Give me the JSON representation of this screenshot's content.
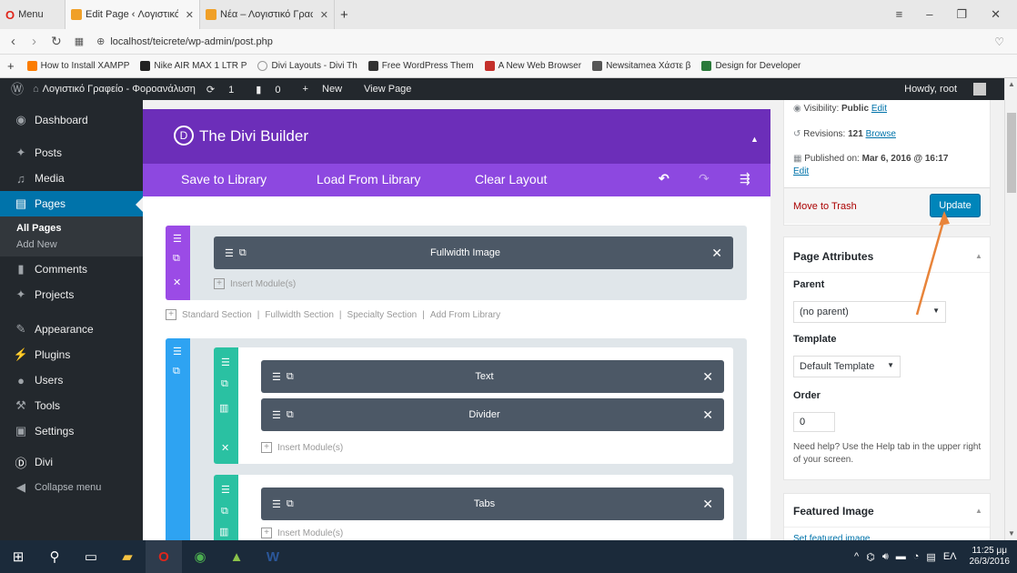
{
  "browser": {
    "menu_label": "Menu",
    "tabs": [
      {
        "label": "Edit Page ‹ Λογιστικό Γρα…"
      },
      {
        "label": "Νέα – Λογιστικό Γραφείο"
      }
    ],
    "url": "localhost/teicrete/wp-admin/post.php",
    "bookmarks": [
      {
        "label": "How to Install XAMPP"
      },
      {
        "label": "Nike AIR MAX 1 LTR P"
      },
      {
        "label": "Divi Layouts - Divi Th"
      },
      {
        "label": "Free WordPress Them"
      },
      {
        "label": "A New Web Browser"
      },
      {
        "label": "Newsitamea Χάστε β"
      },
      {
        "label": "Design for Developer"
      }
    ]
  },
  "adminbar": {
    "site_name": "Λογιστικό Γραφείο - Φοροανάλυση",
    "updates": "1",
    "comments": "0",
    "new_label": "New",
    "view_label": "View Page",
    "howdy": "Howdy, root"
  },
  "sidebar": {
    "items": [
      {
        "label": "Dashboard",
        "icon": "dashboard-icon"
      },
      {
        "label": "Posts",
        "icon": "pin-icon"
      },
      {
        "label": "Media",
        "icon": "media-icon"
      },
      {
        "label": "Pages",
        "icon": "page-icon"
      },
      {
        "label": "Comments",
        "icon": "comment-icon"
      },
      {
        "label": "Projects",
        "icon": "pin-icon"
      },
      {
        "label": "Appearance",
        "icon": "brush-icon"
      },
      {
        "label": "Plugins",
        "icon": "plug-icon"
      },
      {
        "label": "Users",
        "icon": "user-icon"
      },
      {
        "label": "Tools",
        "icon": "wrench-icon"
      },
      {
        "label": "Settings",
        "icon": "settings-icon"
      },
      {
        "label": "Divi",
        "icon": "divi-icon"
      },
      {
        "label": "Collapse menu",
        "icon": "collapse-icon"
      }
    ],
    "submenu": [
      "All Pages",
      "Add New"
    ]
  },
  "divi": {
    "title": "The Divi Builder",
    "save_library": "Save to Library",
    "load_library": "Load From Library",
    "clear_layout": "Clear Layout",
    "insert_module": "Insert Module(s)",
    "section_links": [
      "Standard Section",
      "Fullwidth Section",
      "Specialty Section",
      "Add From Library"
    ],
    "modules": [
      "Fullwidth Image",
      "Text",
      "Divider",
      "Tabs"
    ]
  },
  "publish": {
    "visibility_label": "Visibility:",
    "visibility_value": "Public",
    "edit": "Edit",
    "revisions_label": "Revisions:",
    "revisions_value": "121",
    "browse": "Browse",
    "published_label": "Published on:",
    "published_value": "Mar 6, 2016 @ 16:17",
    "trash": "Move to Trash",
    "update": "Update"
  },
  "attributes": {
    "title": "Page Attributes",
    "parent_label": "Parent",
    "parent_value": "(no parent)",
    "template_label": "Template",
    "template_value": "Default Template",
    "order_label": "Order",
    "order_value": "0",
    "help": "Need help? Use the Help tab in the upper right of your screen."
  },
  "featured": {
    "title": "Featured Image",
    "set": "Set featured image"
  },
  "taskbar": {
    "lang": "ΕΛ",
    "time": "11:25 μμ",
    "date": "26/3/2016"
  },
  "colors": {
    "divi_dark": "#6c2eb9",
    "divi_light": "#8d48e0",
    "wp_blue": "#0073aa",
    "module": "#4c5866",
    "row": "#2ac1a2",
    "section": "#2ea3f2",
    "arrow": "#e8843a"
  }
}
